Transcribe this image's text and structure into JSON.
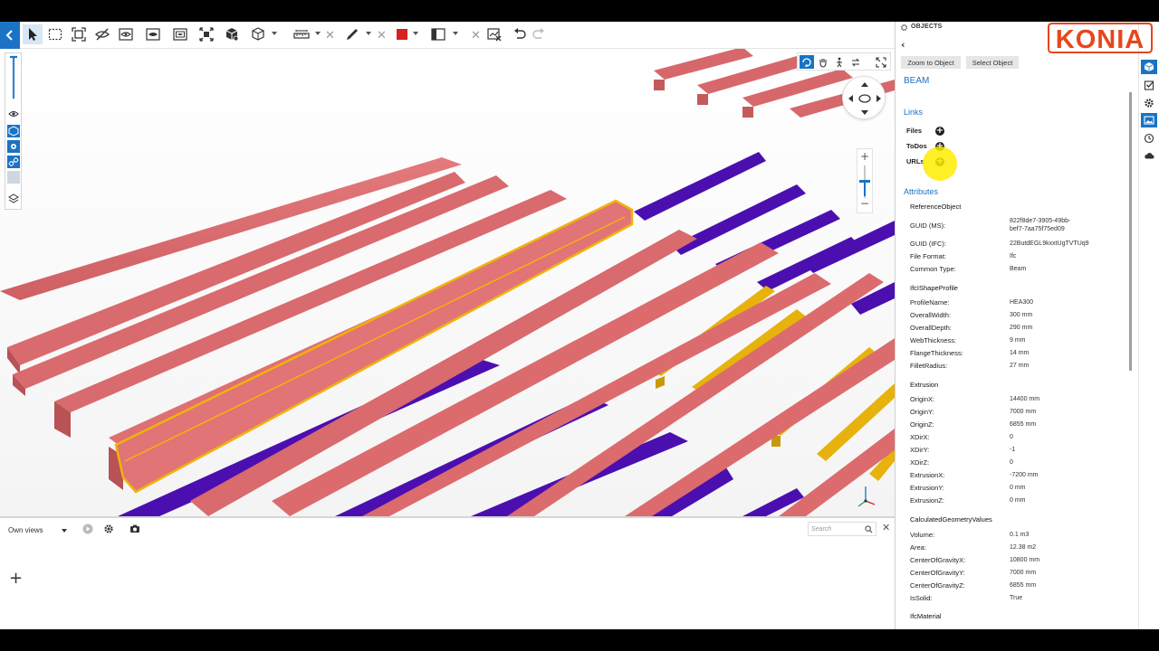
{
  "toolbar": {
    "icons": [
      "back-icon",
      "select-arrow-icon",
      "box-select-icon",
      "fit-view-icon",
      "hide-icon",
      "show-icon",
      "isolate-icon",
      "show-all-icon",
      "explode-icon",
      "cube-view-icon",
      "measure-icon",
      "markup-pen-icon",
      "color-swatch-icon",
      "section-icon",
      "clear-markup-icon",
      "undo-icon",
      "redo-icon"
    ],
    "accent_color": "#1a73c4",
    "markup_color": "#d42121"
  },
  "viewport": {
    "navigation_icons": [
      "orbit-icon",
      "pan-icon",
      "walk-icon",
      "rotate-icon",
      "fullscreen-icon"
    ],
    "zoom_in_label": "+",
    "zoom_out_label": "−",
    "beam_colors": {
      "salmon": "#dc6b6e",
      "purple": "#4b0fb0",
      "yellow": "#e7b20c",
      "highlight": "#f2b20a"
    }
  },
  "bottom_panel": {
    "views_select": "Own views",
    "search_placeholder": "Search",
    "add_view_label": "+",
    "close_label": "✕"
  },
  "properties": {
    "title": "OBJECTS",
    "back_label": "‹",
    "zoom_button": "Zoom to Object",
    "select_button": "Select Object",
    "object_name": "BEAM",
    "links_heading": "Links",
    "links": [
      "Files",
      "ToDos",
      "URLs"
    ],
    "attributes_heading": "Attributes",
    "groups": {
      "reference": {
        "label": "ReferenceObject",
        "rows": [
          {
            "key": "GUID (MS):",
            "value": "822f8de7-3905-49bb-",
            "value2": "bef7-7aa75f75ed09"
          },
          {
            "key": "GUID (IFC):",
            "value": "22ButdEGL9kxxtUgTVTUq9"
          },
          {
            "key": "File Format:",
            "value": "Ifc"
          },
          {
            "key": "Common Type:",
            "value": "Beam"
          }
        ]
      },
      "profile": {
        "label": "IfcIShapeProfile",
        "rows": [
          {
            "key": "ProfileName:",
            "value": "HEA300"
          },
          {
            "key": "OverallWidth:",
            "value": "300 mm"
          },
          {
            "key": "OverallDepth:",
            "value": "290 mm"
          },
          {
            "key": "WebThickness:",
            "value": "9 mm"
          },
          {
            "key": "FlangeThickness:",
            "value": "14 mm"
          },
          {
            "key": "FilletRadius:",
            "value": "27 mm"
          }
        ]
      },
      "extrusion": {
        "label": "Extrusion",
        "rows": [
          {
            "key": "OriginX:",
            "value": "14400 mm"
          },
          {
            "key": "OriginY:",
            "value": "7000 mm"
          },
          {
            "key": "OriginZ:",
            "value": "6855 mm"
          },
          {
            "key": "XDirX:",
            "value": "0"
          },
          {
            "key": "XDirY:",
            "value": "-1"
          },
          {
            "key": "XDirZ:",
            "value": "0"
          },
          {
            "key": "ExtrusionX:",
            "value": "-7200 mm"
          },
          {
            "key": "ExtrusionY:",
            "value": "0 mm"
          },
          {
            "key": "ExtrusionZ:",
            "value": "0 mm"
          }
        ]
      },
      "geometry": {
        "label": "CalculatedGeometryValues",
        "rows": [
          {
            "key": "Volume:",
            "value": "0.1 m3"
          },
          {
            "key": "Area:",
            "value": "12.38 m2"
          },
          {
            "key": "CenterOfGravityX:",
            "value": "10800 mm"
          },
          {
            "key": "CenterOfGravityY:",
            "value": "7000 mm"
          },
          {
            "key": "CenterOfGravityZ:",
            "value": "6855 mm"
          },
          {
            "key": "IsSolid:",
            "value": "True"
          }
        ]
      },
      "material": {
        "label": "IfcMaterial"
      }
    }
  },
  "right_strip": {
    "icons": [
      "model-tree-icon",
      "tasks-icon",
      "settings-icon",
      "image-icon",
      "history-icon",
      "cloud-icon"
    ]
  },
  "logo": {
    "text": "KONIA",
    "color": "#e8461d"
  }
}
